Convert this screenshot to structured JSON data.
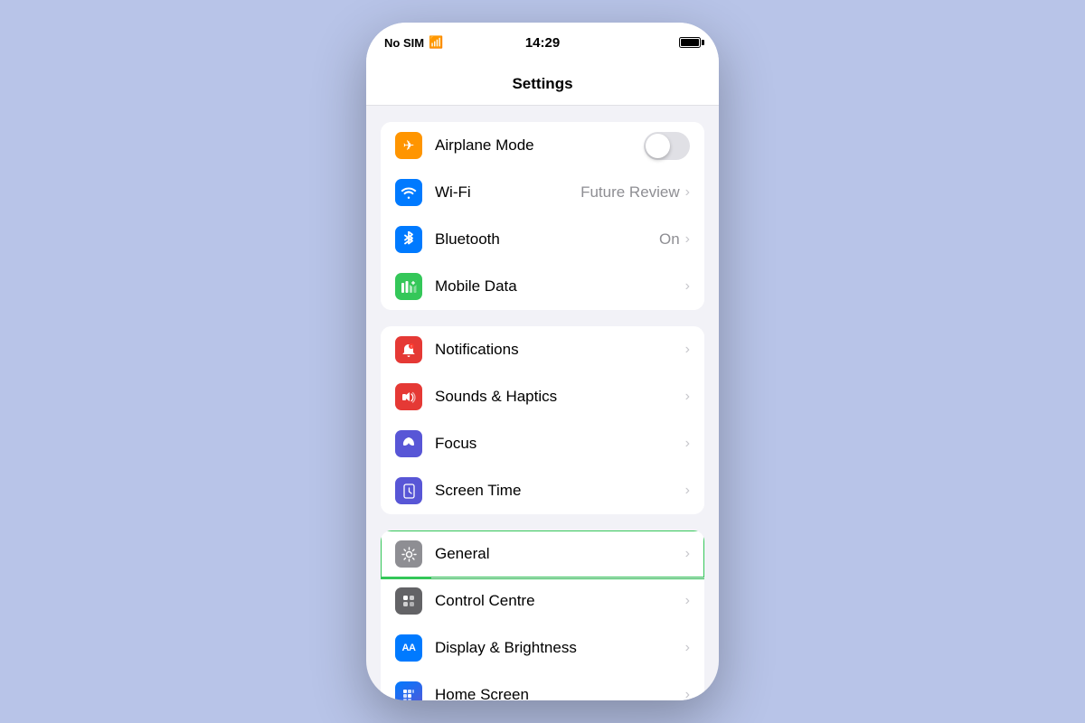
{
  "statusBar": {
    "carrier": "No SIM",
    "time": "14:29"
  },
  "navBar": {
    "title": "Settings"
  },
  "groups": [
    {
      "id": "connectivity",
      "items": [
        {
          "id": "airplane-mode",
          "label": "Airplane Mode",
          "iconBg": "bg-orange",
          "iconSymbol": "✈",
          "type": "toggle",
          "toggleOn": false
        },
        {
          "id": "wifi",
          "label": "Wi-Fi",
          "iconBg": "bg-blue",
          "iconSymbol": "wifi",
          "type": "value",
          "value": "Future Review"
        },
        {
          "id": "bluetooth",
          "label": "Bluetooth",
          "iconBg": "bg-bluetooth",
          "iconSymbol": "bluetooth",
          "type": "value",
          "value": "On"
        },
        {
          "id": "mobile-data",
          "label": "Mobile Data",
          "iconBg": "bg-green",
          "iconSymbol": "mobile",
          "type": "chevron"
        }
      ]
    },
    {
      "id": "notifications",
      "items": [
        {
          "id": "notifications",
          "label": "Notifications",
          "iconBg": "bg-red",
          "iconSymbol": "bell",
          "type": "chevron"
        },
        {
          "id": "sounds-haptics",
          "label": "Sounds & Haptics",
          "iconBg": "bg-red-sound",
          "iconSymbol": "speaker",
          "type": "chevron"
        },
        {
          "id": "focus",
          "label": "Focus",
          "iconBg": "bg-purple",
          "iconSymbol": "moon",
          "type": "chevron"
        },
        {
          "id": "screen-time",
          "label": "Screen Time",
          "iconBg": "bg-purple-screen",
          "iconSymbol": "hourglass",
          "type": "chevron"
        }
      ]
    },
    {
      "id": "general-group",
      "items": [
        {
          "id": "general",
          "label": "General",
          "iconBg": "bg-gray",
          "iconSymbol": "gear",
          "type": "chevron",
          "highlighted": true
        },
        {
          "id": "control-centre",
          "label": "Control Centre",
          "iconBg": "bg-gray2",
          "iconSymbol": "switches",
          "type": "chevron"
        },
        {
          "id": "display-brightness",
          "label": "Display & Brightness",
          "iconBg": "bg-blue-display",
          "iconSymbol": "AA",
          "type": "chevron"
        },
        {
          "id": "home-screen",
          "label": "Home Screen",
          "iconBg": "bg-multicolor",
          "iconSymbol": "grid",
          "type": "chevron"
        }
      ]
    }
  ]
}
